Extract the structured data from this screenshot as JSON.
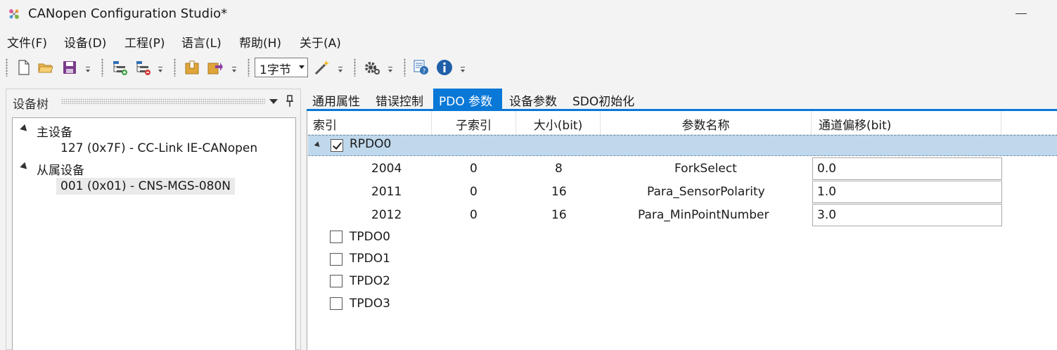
{
  "window": {
    "title": "CANopen Configuration Studio*"
  },
  "menu": [
    {
      "label": "文件(F)"
    },
    {
      "label": "设备(D)"
    },
    {
      "label": "工程(P)"
    },
    {
      "label": "语言(L)"
    },
    {
      "label": "帮助(H)"
    },
    {
      "label": "关于(A)"
    }
  ],
  "toolbar": {
    "size_select": {
      "value": "1字节"
    },
    "icons": [
      "new-file-icon",
      "open-folder-icon",
      "save-icon",
      "add-node-icon",
      "remove-node-icon",
      "import-icon",
      "export-icon",
      "wand-icon",
      "gear-icon",
      "help-icon",
      "info-icon"
    ]
  },
  "tree_panel": {
    "title": "设备树",
    "nodes": [
      {
        "label": "主设备",
        "expanded": true
      },
      {
        "label": "127 (0x7F)  -  CC-Link IE-CANopen"
      },
      {
        "label": "从属设备",
        "expanded": true
      },
      {
        "label": "001 (0x01)  -  CNS-MGS-080N",
        "selected": true
      }
    ]
  },
  "tabs": [
    {
      "label": "通用属性"
    },
    {
      "label": "错误控制"
    },
    {
      "label": "PDO 参数",
      "active": true
    },
    {
      "label": "设备参数"
    },
    {
      "label": "SDO初始化"
    }
  ],
  "grid": {
    "columns": [
      "索引",
      "子索引",
      "大小(bit)",
      "参数名称",
      "通道偏移(bit)"
    ],
    "groups": [
      {
        "name": "RPDO0",
        "checked": true,
        "expanded": true,
        "rows": [
          {
            "index": "2004",
            "subindex": "0",
            "size": "8",
            "name": "ForkSelect",
            "offset": "0.0"
          },
          {
            "index": "2011",
            "subindex": "0",
            "size": "16",
            "name": "Para_SensorPolarity",
            "offset": "1.0"
          },
          {
            "index": "2012",
            "subindex": "0",
            "size": "16",
            "name": "Para_MinPointNumber",
            "offset": "3.0"
          }
        ]
      },
      {
        "name": "TPDO0",
        "checked": false
      },
      {
        "name": "TPDO1",
        "checked": false
      },
      {
        "name": "TPDO2",
        "checked": false
      },
      {
        "name": "TPDO3",
        "checked": false
      }
    ]
  }
}
